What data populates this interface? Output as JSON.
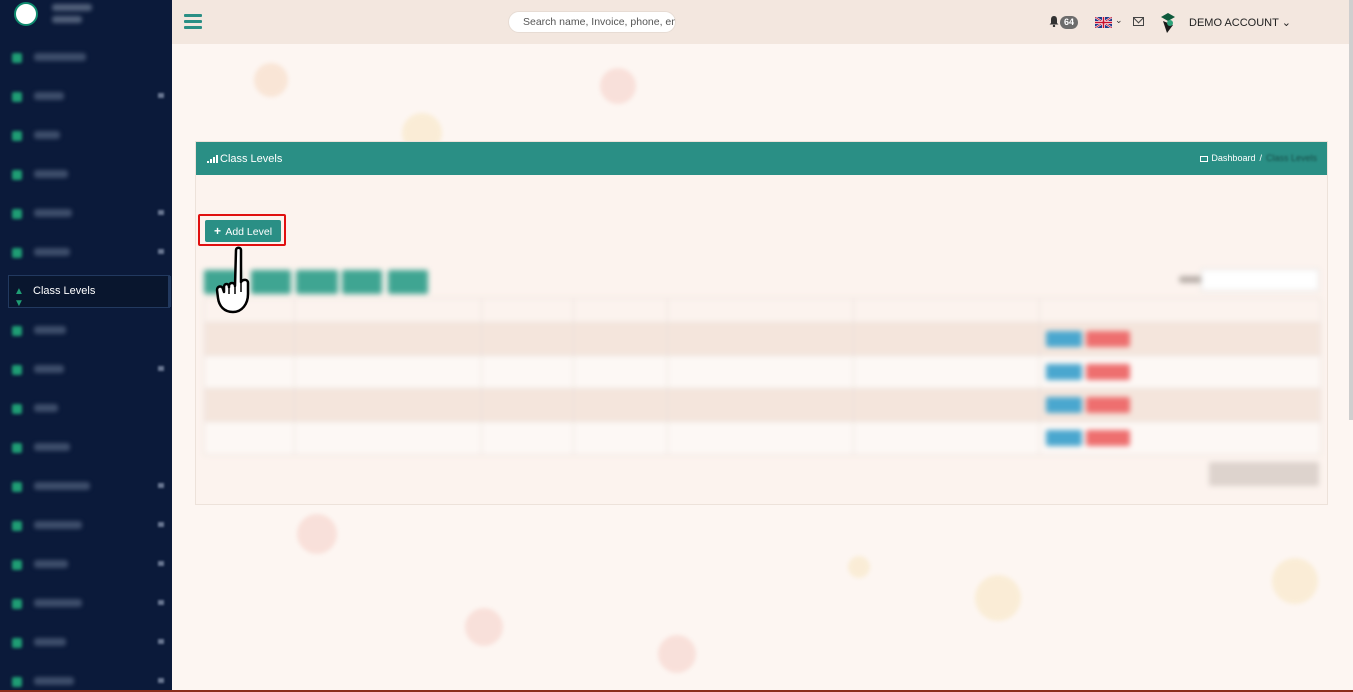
{
  "sidebar": {
    "active_item": {
      "label": "Class Levels",
      "icon": "sort-icon"
    }
  },
  "topbar": {
    "search_placeholder": "Search name, Invoice, phone, email",
    "notifications": "64",
    "account_name": "DEMO ACCOUNT",
    "caret": "⌄"
  },
  "panel": {
    "title": "Class Levels",
    "breadcrumb": {
      "dashboard": "Dashboard",
      "sep": "/",
      "current": "Class Levels"
    },
    "add_button": "Add Level",
    "add_icon": "+"
  },
  "colors": {
    "sidebar": "#0b1a3a",
    "accent": "#2a8f85",
    "highlight": "#e01010"
  }
}
